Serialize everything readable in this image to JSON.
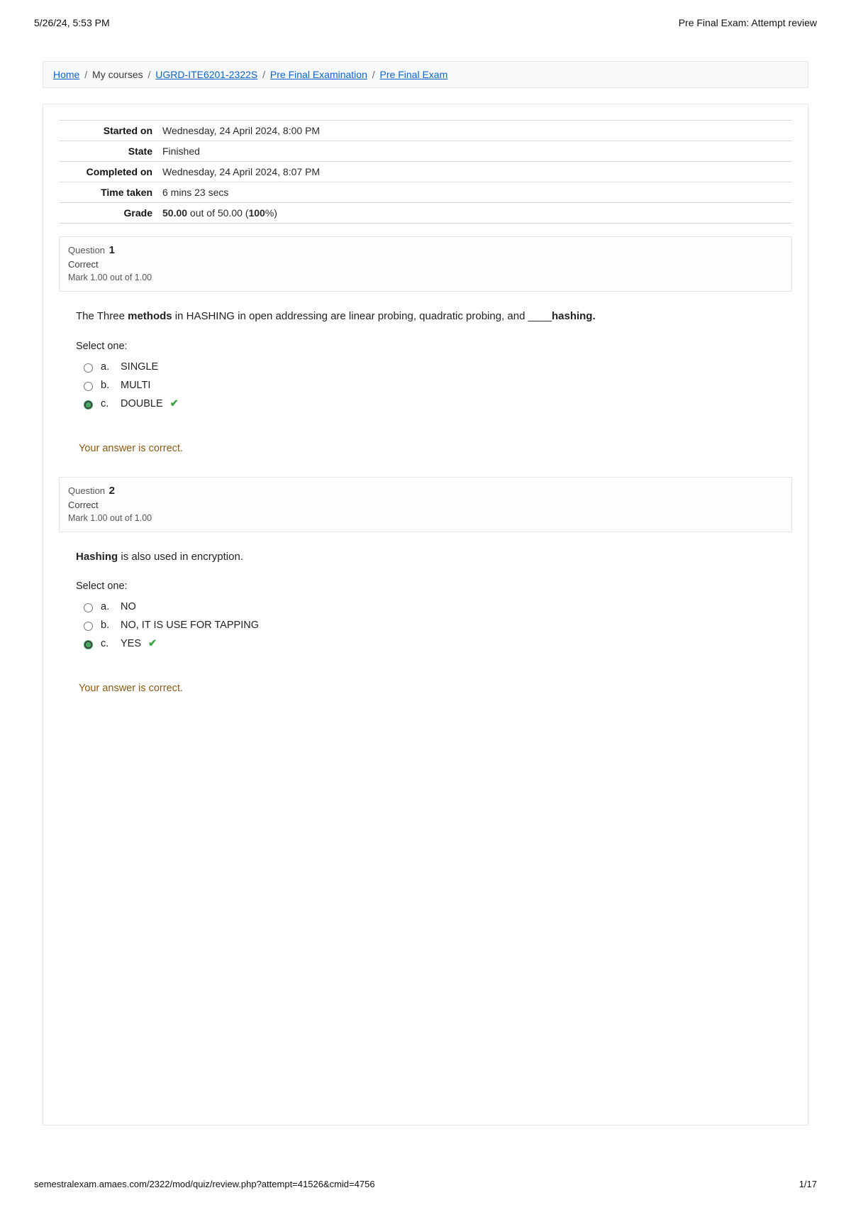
{
  "print": {
    "datetime": "5/26/24, 5:53 PM",
    "doc_title": "Pre Final Exam: Attempt review",
    "footer_url": "semestralexam.amaes.com/2322/mod/quiz/review.php?attempt=41526&cmid=4756",
    "page_num": "1/17"
  },
  "breadcrumb": {
    "home": "Home",
    "my_courses": "My courses",
    "course": "UGRD-ITE6201-2322S",
    "section": "Pre Final Examination",
    "item": "Pre Final Exam"
  },
  "summary": {
    "labels": {
      "started": "Started on",
      "state": "State",
      "completed": "Completed on",
      "time": "Time taken",
      "grade": "Grade"
    },
    "started": "Wednesday, 24 April 2024, 8:00 PM",
    "state": "Finished",
    "completed": "Wednesday, 24 April 2024, 8:07 PM",
    "time": "6 mins 23 secs",
    "grade_prefix": "50.00",
    "grade_mid": " out of 50.00 (",
    "grade_pct": "100",
    "grade_suffix": "%)"
  },
  "common": {
    "question_label": "Question",
    "correct": "Correct",
    "mark": "Mark 1.00 out of 1.00",
    "select_one": "Select one:",
    "feedback_correct": "Your answer is correct."
  },
  "q1": {
    "number": "1",
    "prompt_pre": "The Three ",
    "prompt_bold1": "methods",
    "prompt_mid": " in HASHING in open addressing are linear probing, quadratic probing, and ____",
    "prompt_bold2": "hashing.",
    "options": {
      "a": "SINGLE",
      "b": "MULTI",
      "c": "DOUBLE"
    },
    "selected": "c"
  },
  "q2": {
    "number": "2",
    "prompt_bold": "Hashing",
    "prompt_rest": " is also used in encryption.",
    "options": {
      "a": "NO",
      "b": "NO, IT IS USE FOR TAPPING",
      "c": "YES"
    },
    "selected": "c"
  }
}
